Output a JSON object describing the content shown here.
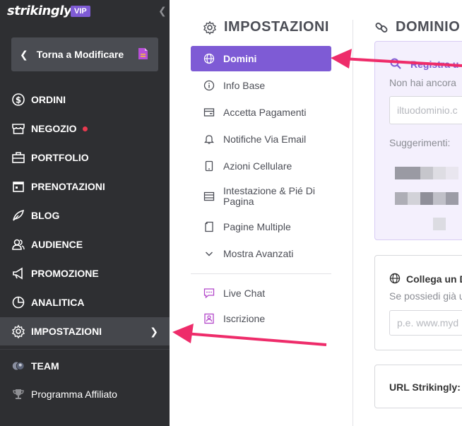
{
  "sidebar": {
    "logo": "strikingly",
    "vip_badge": "VIP",
    "back_button": "Torna a Modificare",
    "items": [
      {
        "label": "ORDINI",
        "icon": "dollar-circle-icon"
      },
      {
        "label": "NEGOZIO",
        "icon": "store-icon",
        "badge": "notification-dot"
      },
      {
        "label": "PORTFOLIO",
        "icon": "briefcase-icon"
      },
      {
        "label": "PRENOTAZIONI",
        "icon": "calendar-icon"
      },
      {
        "label": "BLOG",
        "icon": "quill-icon"
      },
      {
        "label": "AUDIENCE",
        "icon": "users-icon"
      },
      {
        "label": "PROMOZIONE",
        "icon": "megaphone-icon"
      },
      {
        "label": "ANALITICA",
        "icon": "pie-chart-icon"
      },
      {
        "label": "IMPOSTAZIONI",
        "icon": "gear-icon",
        "active": true
      },
      {
        "label": "TEAM",
        "icon": "team-avatar-icon"
      },
      {
        "label": "Programma Affiliato",
        "icon": "trophy-icon"
      }
    ]
  },
  "settings": {
    "title": "IMPOSTAZIONI",
    "menu": [
      {
        "label": "Domini",
        "icon": "globe-icon",
        "active": true
      },
      {
        "label": "Info Base",
        "icon": "info-icon"
      },
      {
        "label": "Accetta Pagamenti",
        "icon": "card-icon"
      },
      {
        "label": "Notifiche Via Email",
        "icon": "bell-icon"
      },
      {
        "label": "Azioni Cellulare",
        "icon": "mobile-icon"
      },
      {
        "label": "Intestazione & Pié Di Pagina",
        "icon": "layout-icon"
      },
      {
        "label": "Pagine Multiple",
        "icon": "pages-icon"
      },
      {
        "label": "Mostra Avanzati",
        "icon": "chevron-down-icon"
      },
      {
        "label": "Live Chat",
        "icon": "chat-icon"
      },
      {
        "label": "Iscrizione",
        "icon": "signup-icon"
      }
    ]
  },
  "domain": {
    "title": "DOMINIO",
    "register": {
      "title": "Registra u",
      "text": "Non hai ancora",
      "placeholder": "iltuodominio.c",
      "suggestions_label": "Suggerimenti:"
    },
    "connect": {
      "title": "Collega un D",
      "text": "Se possiedi già u",
      "placeholder": "p.e. www.myd"
    },
    "strikingly_url": {
      "title": "URL Strikingly:"
    }
  },
  "colors": {
    "sidebar_bg": "#2e2f32",
    "accent": "#7e5bd5",
    "annotation_arrow": "#ee2c6a"
  }
}
